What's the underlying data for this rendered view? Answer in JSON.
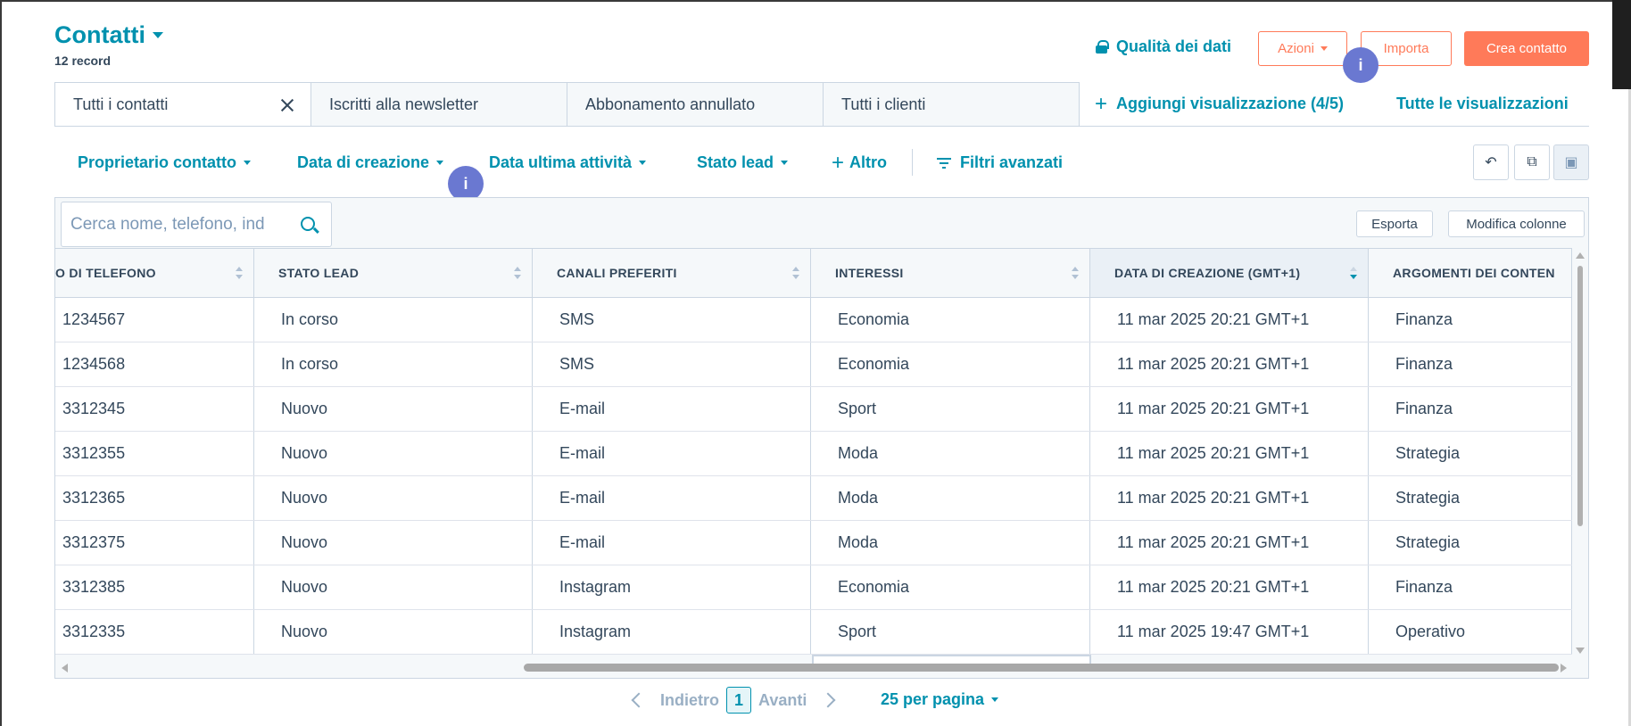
{
  "header": {
    "title": "Contatti",
    "record_count": "12 record",
    "quality": "Qualità dei dati",
    "actions": "Azioni",
    "import": "Importa",
    "create": "Crea contatto",
    "info": "i"
  },
  "tabs": [
    {
      "label": "Tutti i contatti"
    },
    {
      "label": "Iscritti alla newsletter"
    },
    {
      "label": "Abbonamento annullato"
    },
    {
      "label": "Tutti i clienti"
    }
  ],
  "views": {
    "add": "Aggiungi visualizzazione (4/5)",
    "all": "Tutte le visualizzazioni"
  },
  "filters": {
    "owner": "Proprietario contatto",
    "created": "Data di creazione",
    "last_activity": "Data ultima attività",
    "lead_status": "Stato lead",
    "more": "Altro",
    "advanced": "Filtri avanzati"
  },
  "toolbar_icons": [
    "undo-icon",
    "copy-icon",
    "save-icon"
  ],
  "table": {
    "search_placeholder": "Cerca nome, telefono, ind",
    "export": "Esporta",
    "edit_columns": "Modifica colonne",
    "columns": [
      "O DI TELEFONO",
      "STATO LEAD",
      "CANALI PREFERITI",
      "INTERESSI",
      "DATA DI CREAZIONE (GMT+1)",
      "ARGOMENTI DEI CONTEN"
    ],
    "rows": [
      [
        "1234567",
        "In corso",
        "SMS",
        "Economia",
        "11 mar 2025 20:21 GMT+1",
        "Finanza"
      ],
      [
        "1234568",
        "In corso",
        "SMS",
        "Economia",
        "11 mar 2025 20:21 GMT+1",
        "Finanza"
      ],
      [
        "3312345",
        "Nuovo",
        "E-mail",
        "Sport",
        "11 mar 2025 20:21 GMT+1",
        "Finanza"
      ],
      [
        "3312355",
        "Nuovo",
        "E-mail",
        "Moda",
        "11 mar 2025 20:21 GMT+1",
        "Strategia"
      ],
      [
        "3312365",
        "Nuovo",
        "E-mail",
        "Moda",
        "11 mar 2025 20:21 GMT+1",
        "Strategia"
      ],
      [
        "3312375",
        "Nuovo",
        "E-mail",
        "Moda",
        "11 mar 2025 20:21 GMT+1",
        "Strategia"
      ],
      [
        "3312385",
        "Nuovo",
        "Instagram",
        "Economia",
        "11 mar 2025 20:21 GMT+1",
        "Finanza"
      ],
      [
        "3312335",
        "Nuovo",
        "Instagram",
        "Sport",
        "11 mar 2025 19:47 GMT+1",
        "Operativo"
      ]
    ]
  },
  "pagination": {
    "prev": "Indietro",
    "page": "1",
    "next": "Avanti",
    "per_page": "25 per pagina"
  }
}
